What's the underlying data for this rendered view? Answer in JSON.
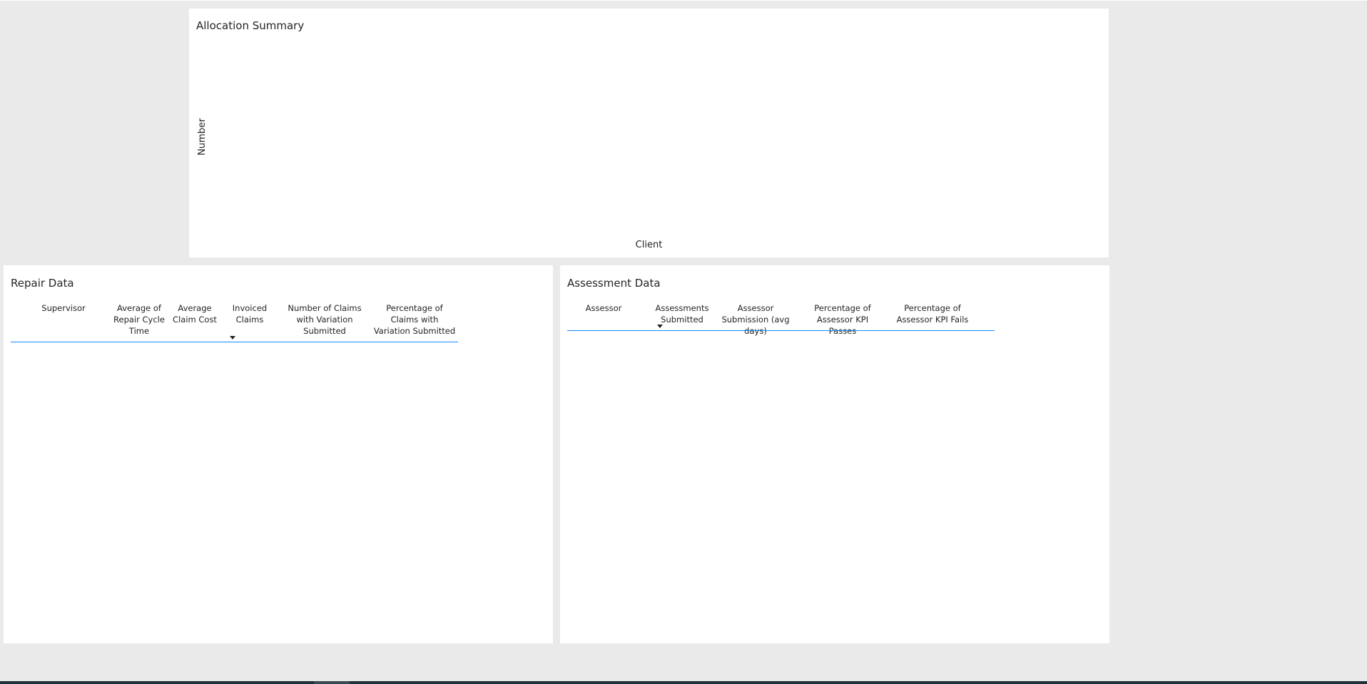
{
  "allocation_summary": {
    "title": "Allocation Summary",
    "y_axis_title": "Number",
    "x_axis_title": "Client"
  },
  "repair_data": {
    "title": "Repair Data",
    "columns": [
      "Supervisor",
      "Average of Repair Cycle Time",
      "Average Claim Cost",
      "Invoiced Claims",
      "Number of Claims with Variation Submitted",
      "Percentage of Claims with Variation Submitted"
    ],
    "sorted_column": "Invoiced Claims",
    "sort_direction": "descending"
  },
  "assessment_data": {
    "title": "Assessment Data",
    "columns": [
      "Assessor",
      "Assessments Submitted",
      "Assessor Submission (avg days)",
      "Percentage of Assessor KPI Passes",
      "Percentage of Assessor KPI Fails"
    ],
    "sorted_column": "Assessments Submitted",
    "sort_direction": "descending"
  },
  "colors": {
    "canvas_background": "#eaeaea",
    "card_background": "#ffffff",
    "header_rule": "#118dff",
    "taskbar": "#233038"
  },
  "icons": {
    "sort": "caret-down-icon"
  }
}
